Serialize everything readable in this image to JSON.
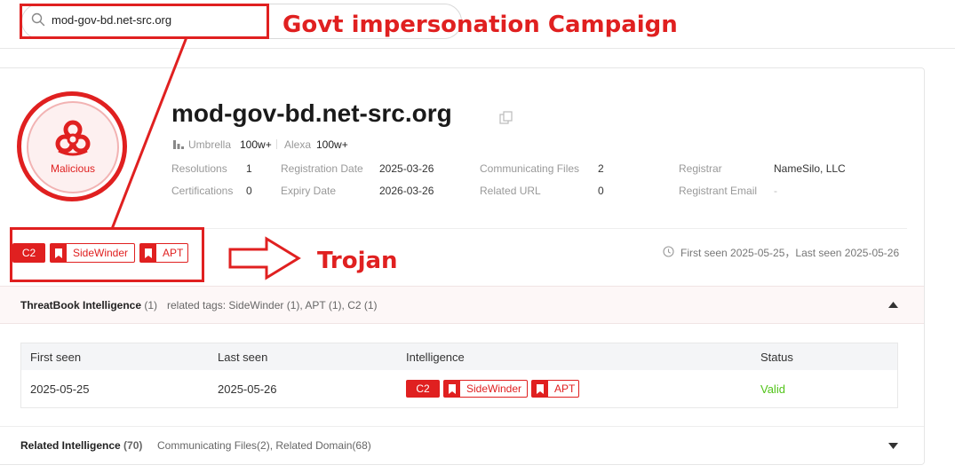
{
  "search": {
    "value": "mod-gov-bd.net-src.org"
  },
  "annotations": {
    "campaign_label": "Govt impersonation Campaign",
    "trojan_label": "Trojan"
  },
  "verdict": {
    "label": "Malicious",
    "color": "#e02020"
  },
  "domain": {
    "name": "mod-gov-bd.net-src.org",
    "umbrella_label": "Umbrella",
    "umbrella_value": "100w+",
    "alexa_label": "Alexa",
    "alexa_value": "100w+"
  },
  "details": {
    "resolutions_label": "Resolutions",
    "resolutions_value": "1",
    "certifications_label": "Certifications",
    "certifications_value": "0",
    "registration_label": "Registration Date",
    "registration_value": "2025-03-26",
    "expiry_label": "Expiry Date",
    "expiry_value": "2026-03-26",
    "comm_files_label": "Communicating Files",
    "comm_files_value": "2",
    "related_url_label": "Related URL",
    "related_url_value": "0",
    "registrar_label": "Registrar",
    "registrar_value": "NameSilo, LLC",
    "registrant_email_label": "Registrant Email",
    "registrant_email_value": "-"
  },
  "tags": [
    "C2",
    "SideWinder",
    "APT"
  ],
  "seen": {
    "text": "First seen 2025-05-25，Last seen 2025-05-26"
  },
  "threatbook": {
    "title": "ThreatBook Intelligence",
    "count": "(1)",
    "related_tags": "related tags: SideWinder (1), APT (1), C2 (1)"
  },
  "table": {
    "headers": [
      "First seen",
      "Last seen",
      "Intelligence",
      "Status"
    ],
    "row": {
      "first_seen": "2025-05-25",
      "last_seen": "2025-05-26",
      "tags": [
        "C2",
        "SideWinder",
        "APT"
      ],
      "status": "Valid"
    }
  },
  "related": {
    "title": "Related Intelligence",
    "count": "(70)",
    "summary": "Communicating Files(2), Related Domain(68)"
  },
  "colors": {
    "accent": "#e02020",
    "valid": "#52c41a"
  }
}
